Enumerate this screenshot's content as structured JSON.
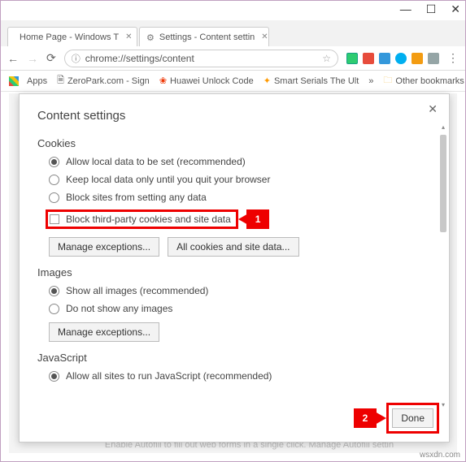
{
  "window": {
    "min": "—",
    "max": "☐",
    "close": "✕"
  },
  "tabs": [
    {
      "title": "Home Page - Windows T"
    },
    {
      "title": "Settings - Content settin"
    }
  ],
  "nav": {
    "back": "←",
    "forward": "→",
    "reload": "⟳",
    "menu": "⋮"
  },
  "url": {
    "info": "ⓘ",
    "text": "chrome://settings/content",
    "star": "☆"
  },
  "ext_colors": [
    "#2ecc71",
    "#e74c3c",
    "#3498db",
    "#1abc9c",
    "#f39c12",
    "#7f8c8d"
  ],
  "bookmarks": {
    "apps": "Apps",
    "items": [
      "ZeroPark.com - Sign",
      "Huawei Unlock Code",
      "Smart Serials The Ult"
    ],
    "more": "»",
    "other": "Other bookmarks"
  },
  "dialog": {
    "title": "Content settings",
    "close": "✕",
    "cookies": {
      "head": "Cookies",
      "opt1": "Allow local data to be set (recommended)",
      "opt2": "Keep local data only until you quit your browser",
      "opt3": "Block sites from setting any data",
      "cb": "Block third-party cookies and site data",
      "btn1": "Manage exceptions...",
      "btn2": "All cookies and site data..."
    },
    "images": {
      "head": "Images",
      "opt1": "Show all images (recommended)",
      "opt2": "Do not show any images",
      "btn1": "Manage exceptions..."
    },
    "js": {
      "head": "JavaScript",
      "opt1": "Allow all sites to run JavaScript (recommended)"
    },
    "done": "Done"
  },
  "callout": {
    "n1": "1",
    "n2": "2"
  },
  "bg_text": "Enable Autofill to fill out web forms in a single click. Manage Autofill settin",
  "watermark": "wsxdn.com"
}
